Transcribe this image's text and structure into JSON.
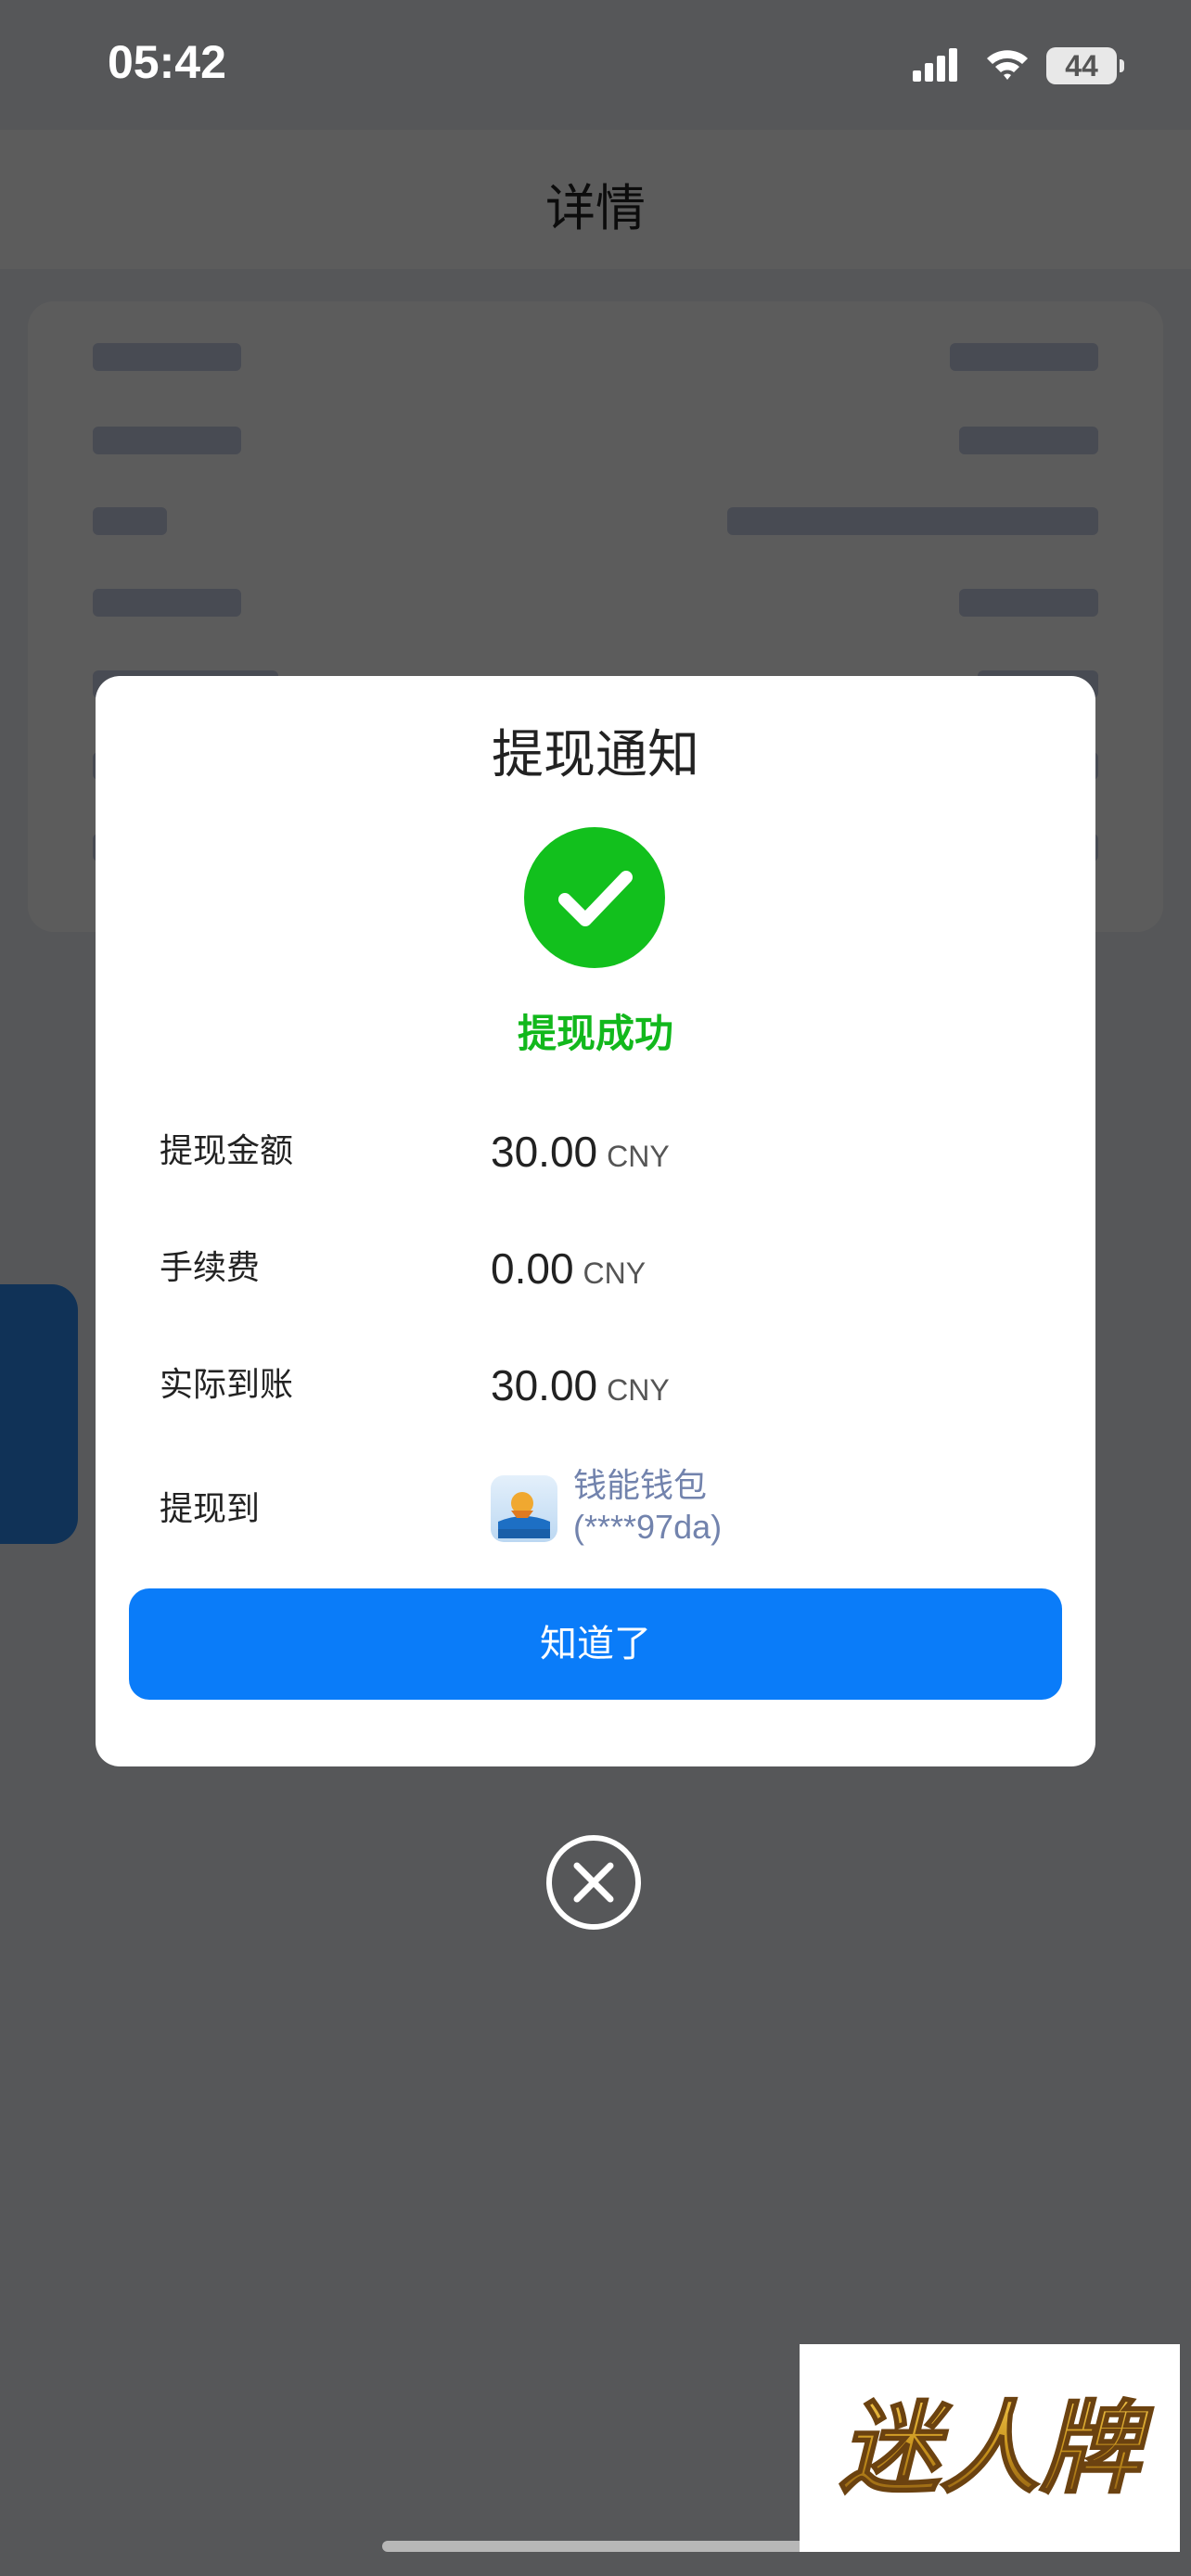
{
  "status_bar": {
    "time": "05:42",
    "battery": "44"
  },
  "background": {
    "title": "详情",
    "rows": [
      {
        "label_w": 160,
        "value_w": 160
      },
      {
        "label_w": 160,
        "value_w": 150
      },
      {
        "label_w": 80,
        "value_w": 400
      },
      {
        "label_w": 160,
        "value_w": 150
      },
      {
        "label_w": 200,
        "value_w": 130
      },
      {
        "label_w": 120,
        "value_w": 180
      },
      {
        "label_w": 140,
        "value_w": 150
      }
    ]
  },
  "modal": {
    "title": "提现通知",
    "status": "提现成功",
    "rows": [
      {
        "label": "提现金额",
        "amount": "30.00",
        "currency": "CNY"
      },
      {
        "label": "手续费",
        "amount": "0.00",
        "currency": "CNY"
      },
      {
        "label": "实际到账",
        "amount": "30.00",
        "currency": "CNY"
      }
    ],
    "destination": {
      "label": "提现到",
      "wallet_name": "钱能钱包",
      "account": "(****97da)"
    },
    "confirm_button": "知道了"
  },
  "watermark": {
    "text": "迷人牌"
  },
  "colors": {
    "success": "#12c01d",
    "primary": "#0a7cf9",
    "wallet_text": "#7283ad",
    "watermark_gold": "#c7921c"
  },
  "icons": {
    "success": "check-circle-icon",
    "close": "close-circle-icon",
    "back": "chevron-left-icon"
  }
}
